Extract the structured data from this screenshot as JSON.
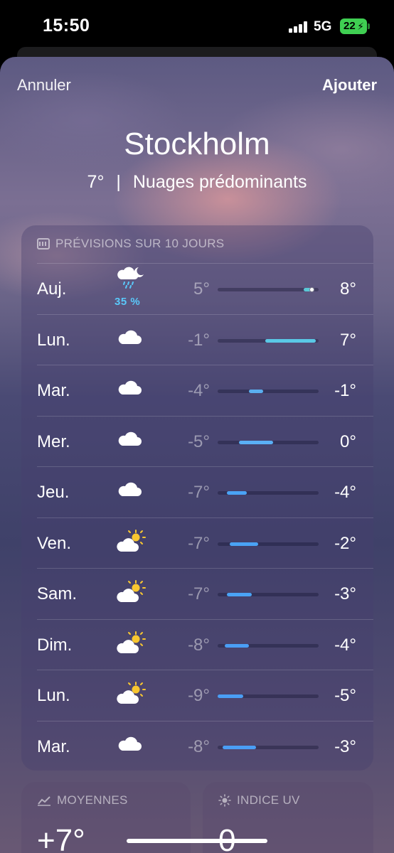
{
  "status_bar": {
    "time": "15:50",
    "network": "5G",
    "battery": "22"
  },
  "nav": {
    "cancel_label": "Annuler",
    "add_label": "Ajouter"
  },
  "location": {
    "city": "Stockholm",
    "current_temp": "7°",
    "separator": "|",
    "condition": "Nuages prédominants"
  },
  "forecast": {
    "header": "PRÉVISIONS SUR 10 JOURS",
    "days": [
      {
        "day": "Auj.",
        "icon": "cloud-moon-rain-icon",
        "precip": "35 %",
        "low": "5°",
        "high": "8°",
        "bar_start": 0.85,
        "bar_end": 0.96,
        "current": 0.93,
        "color": "#5ac8d6"
      },
      {
        "day": "Lun.",
        "icon": "cloud-icon",
        "precip": "",
        "low": "-1°",
        "high": "7°",
        "bar_start": 0.47,
        "bar_end": 0.97,
        "color": "#5ac8e6"
      },
      {
        "day": "Mar.",
        "icon": "cloud-icon",
        "precip": "",
        "low": "-4°",
        "high": "-1°",
        "bar_start": 0.31,
        "bar_end": 0.45,
        "color": "#5aaff0"
      },
      {
        "day": "Mer.",
        "icon": "cloud-icon",
        "precip": "",
        "low": "-5°",
        "high": "0°",
        "bar_start": 0.21,
        "bar_end": 0.55,
        "color": "#5aaff5"
      },
      {
        "day": "Jeu.",
        "icon": "cloud-icon",
        "precip": "",
        "low": "-7°",
        "high": "-4°",
        "bar_start": 0.09,
        "bar_end": 0.29,
        "color": "#4aa3f5"
      },
      {
        "day": "Ven.",
        "icon": "cloud-sun-icon",
        "precip": "",
        "low": "-7°",
        "high": "-2°",
        "bar_start": 0.12,
        "bar_end": 0.4,
        "color": "#4aa3f5"
      },
      {
        "day": "Sam.",
        "icon": "cloud-sun-icon",
        "precip": "",
        "low": "-7°",
        "high": "-3°",
        "bar_start": 0.09,
        "bar_end": 0.34,
        "color": "#4aa3f5"
      },
      {
        "day": "Dim.",
        "icon": "cloud-sun-icon",
        "precip": "",
        "low": "-8°",
        "high": "-4°",
        "bar_start": 0.07,
        "bar_end": 0.31,
        "color": "#4a9ef5"
      },
      {
        "day": "Lun.",
        "icon": "cloud-sun-icon",
        "precip": "",
        "low": "-9°",
        "high": "-5°",
        "bar_start": 0.0,
        "bar_end": 0.25,
        "color": "#4a9ef5"
      },
      {
        "day": "Mar.",
        "icon": "cloud-icon",
        "precip": "",
        "low": "-8°",
        "high": "-3°",
        "bar_start": 0.05,
        "bar_end": 0.38,
        "color": "#4a9ef5"
      }
    ]
  },
  "averages": {
    "header": "MOYENNES",
    "value": "+7°"
  },
  "uv_index": {
    "header": "INDICE UV",
    "value": "0"
  }
}
